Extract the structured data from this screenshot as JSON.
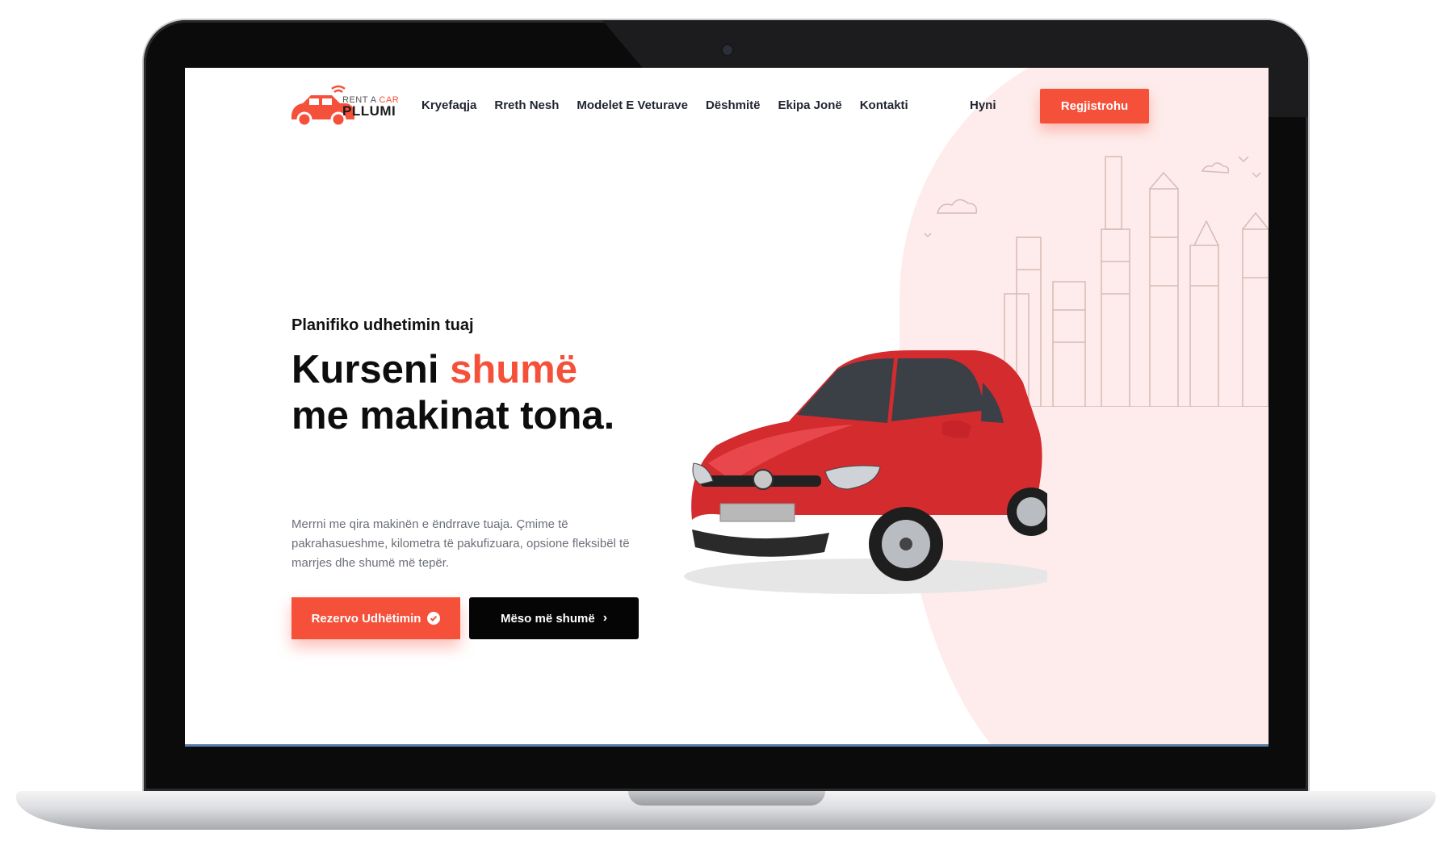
{
  "brand": {
    "logo_top_text": "RENT A",
    "logo_top_accent": "CAR",
    "logo_name": "PLLUMI"
  },
  "nav": {
    "items": [
      {
        "label": "Kryefaqja"
      },
      {
        "label": "Rreth Nesh"
      },
      {
        "label": "Modelet E Veturave"
      },
      {
        "label": "Dëshmitë"
      },
      {
        "label": "Ekipa Jonë"
      },
      {
        "label": "Kontakti"
      }
    ],
    "login_label": "Hyni",
    "register_label": "Regjistrohu"
  },
  "hero": {
    "subtitle": "Planifiko udhetimin tuaj",
    "headline_part1": "Kurseni ",
    "headline_accent": "shumë",
    "headline_part2": "me makinat tona.",
    "description": "Merrni me qira makinën e ëndrrave tuaja. Çmime të pakrahasueshme, kilometra të pakufizuara, opsione fleksibël të marrjes dhe shumë më tepër.",
    "primary_button": "Rezervo Udhëtimin",
    "secondary_button": "Mëso më shumë"
  },
  "colors": {
    "accent": "#f5503a",
    "dark": "#050505",
    "blob": "#fdeceb"
  }
}
